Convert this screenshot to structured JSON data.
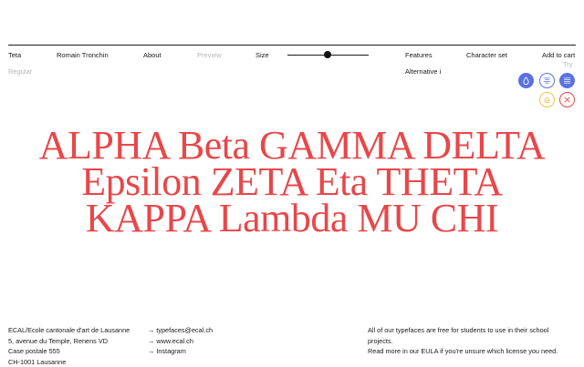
{
  "nav": {
    "font_name": "Teta",
    "designer": "Romain Tronchin",
    "about": "About",
    "preview": "Preview",
    "size": "Size",
    "features": "Features",
    "character_set": "Character set",
    "add_to_cart": "Add to cart",
    "try": "Try"
  },
  "style_label": "Regular",
  "feature_selected": "Alternative i",
  "size_slider": {
    "value_fraction": 0.5
  },
  "tools": [
    {
      "icon": "drop-icon",
      "state": "active"
    },
    {
      "icon": "align-center-icon",
      "state": "outline"
    },
    {
      "icon": "align-justify-icon",
      "state": "active"
    },
    {
      "icon": "invert-icon",
      "state": "outline"
    },
    {
      "icon": "close-icon",
      "state": "outline"
    }
  ],
  "colors": {
    "accent": "#e8474a",
    "tool_blue": "#5a72e0",
    "tool_yellow": "#e9c545"
  },
  "specimen": {
    "lines": [
      "ALPHA Beta GAMMA DELTA",
      "Epsilon ZETA Eta THETA",
      "KAPPA Lambda MU CHI"
    ]
  },
  "footer": {
    "address": [
      "ECAL/Ecole cantonale d'art de Lausanne",
      "5, avenue du Temple, Renens VD",
      "Case postale 555",
      "CH-1001 Lausanne"
    ],
    "links": [
      "→ typefaces@ecal.ch",
      "→ www.ecal.ch",
      "→ Instagram"
    ],
    "notice": [
      "All of our typefaces are free for students to use in their school",
      "projects.",
      "Read more in our EULA if you're unsure which license you need."
    ]
  }
}
